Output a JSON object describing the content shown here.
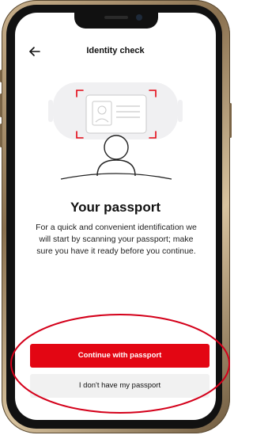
{
  "header": {
    "title": "Identity check",
    "back_icon": "arrow-left-icon"
  },
  "illustration": {
    "icon": "passport-scan-illustration"
  },
  "content": {
    "headline": "Your passport",
    "description": "For a quick and convenient identification we will start by scanning your passport; make sure you have it ready before you continue."
  },
  "actions": {
    "primary_label": "Continue with passport",
    "secondary_label": "I don't have my passport"
  },
  "colors": {
    "accent": "#e30613",
    "secondary_bg": "#f1f1f1",
    "annotation": "#d4001a"
  }
}
